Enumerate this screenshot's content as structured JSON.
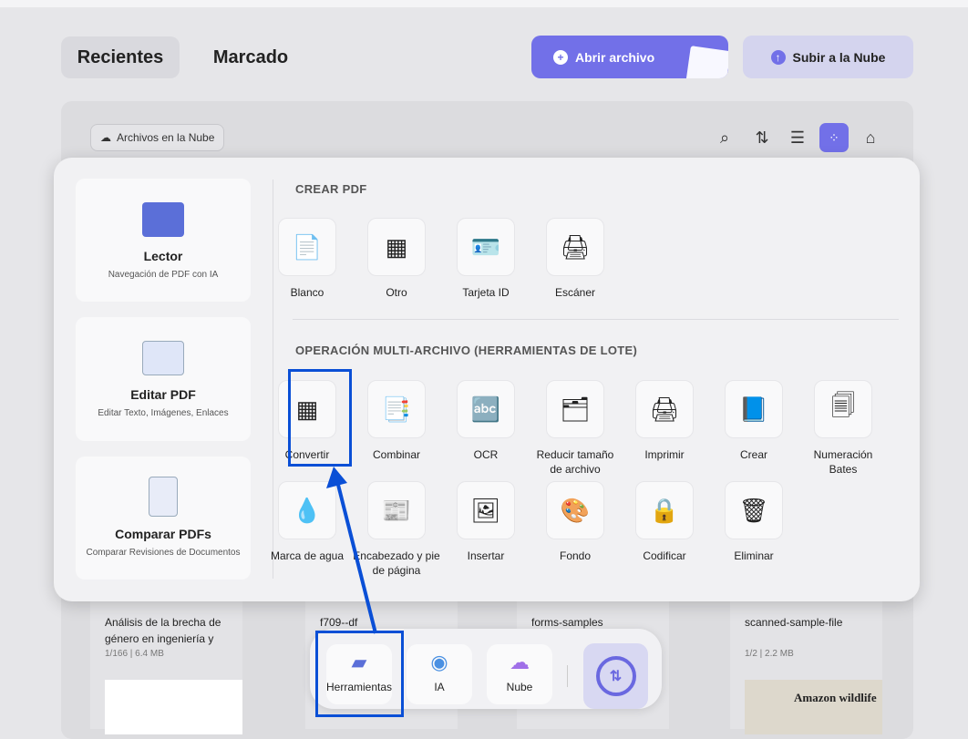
{
  "tabs": {
    "recent": "Recientes",
    "marked": "Marcado"
  },
  "actions": {
    "open": "Abrir archivo",
    "upload": "Subir a la Nube"
  },
  "cloud_chip": "Archivos en la Nube",
  "toolbar_icons": [
    "search-icon",
    "sort-icon",
    "list-view-icon",
    "grid-view-icon",
    "clean-icon"
  ],
  "left_cards": [
    {
      "name": "Lector",
      "desc": "Navegación de PDF con IA"
    },
    {
      "name": "Editar PDF",
      "desc": "Editar Texto, Imágenes, Enlaces"
    },
    {
      "name": "Comparar PDFs",
      "desc": "Comparar Revisiones de Documentos"
    }
  ],
  "create": {
    "title": "CREAR PDF",
    "items": [
      "Blanco",
      "Otro",
      "Tarjeta ID",
      "Escáner"
    ]
  },
  "batch": {
    "title": "OPERACIÓN MULTI-ARCHIVO (HERRAMIENTAS DE LOTE)",
    "row1": [
      "Convertir",
      "Combinar",
      "OCR",
      "Reducir tamaño de archivo",
      "Imprimir",
      "Crear",
      "Numeración Bates"
    ],
    "row2": [
      "Marca de agua",
      "Encabezado y pie de página",
      "Insertar",
      "Fondo",
      "Codificar",
      "Eliminar"
    ]
  },
  "files": [
    {
      "title": "Análisis de la brecha de género en ingeniería y",
      "meta": "1/166 | 6.4 MB"
    },
    {
      "title": "f709--df",
      "meta": ""
    },
    {
      "title": "forms-samples",
      "meta": ""
    },
    {
      "title": "scanned-sample-file",
      "meta": "1/2 | 2.2 MB",
      "thumb": "Amazon wildlife"
    }
  ],
  "dock": [
    "Herramientas",
    "IA",
    "Nube"
  ],
  "colors": {
    "accent": "#7270e8",
    "highlight": "#0a4fd6"
  }
}
